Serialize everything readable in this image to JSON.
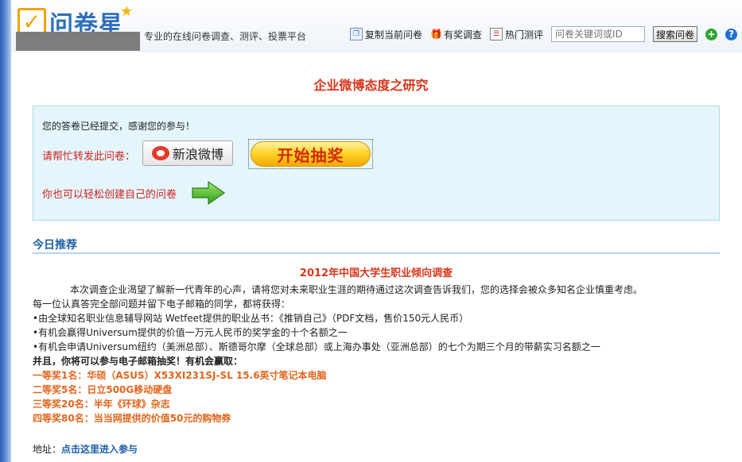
{
  "header": {
    "logo_text": "问卷星",
    "slogan": "专业的在线问卷调查、测评、投票平台",
    "links": [
      {
        "label": "复制当前问卷",
        "icon": "copy-icon"
      },
      {
        "label": "有奖调查",
        "icon": "gift-icon"
      },
      {
        "label": "热门测评",
        "icon": "list-icon"
      }
    ],
    "search": {
      "placeholder": "问卷关键词或ID",
      "button_label": "搜索问卷"
    }
  },
  "page_title": "企业微博态度之研究",
  "notice": {
    "submitted_text": "您的答卷已经提交，感谢您的参与！",
    "share_prompt": "请帮忙转发此问卷：",
    "weibo_label": "新浪微博",
    "lottery_label": "开始抽奖",
    "create_prompt": "你也可以轻松创建自己的问卷"
  },
  "recommend": {
    "section_title": "今日推荐",
    "survey_title": "2012年中国大学生职业倾向调查",
    "lines": [
      "本次调查企业渴望了解新一代青年的心声，请将您对未来职业生涯的期待通过这次调查告诉我们，您的选择会被众多知名企业慎重考虑。",
      "每一位认真答完全部问题并留下电子邮箱的同学，都将获得：",
      "•由全球知名职业信息辅导网站 Wetfeet提供的职业丛书：《推销自己》（PDF文档，售价150元人民币）",
      "•有机会赢得Universum提供的价值一万元人民币的奖学金的十个名额之一",
      "•有机会申请Universum纽约（美洲总部）、斯德哥尔摩（全球总部）或上海办事处（亚洲总部）的七个为期三个月的带薪实习名额之一",
      "并且，你将可以参与电子邮箱抽奖！有机会赢取："
    ],
    "prizes": [
      "一等奖1名：华硕（ASUS）X53XI231SJ-SL 15.6英寸笔记本电脑",
      "二等奖5名：日立500G移动硬盘",
      "三等奖20名：半年《环球》杂志",
      "四等奖80名：当当网提供的价值50元的购物券"
    ],
    "address_label": "地址：",
    "address_link": "点击这里进入参与"
  }
}
